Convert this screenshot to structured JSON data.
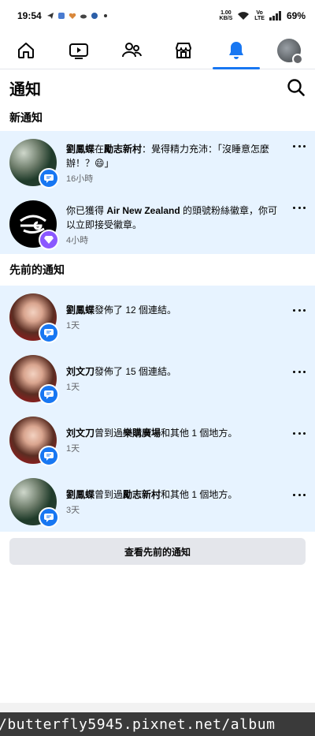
{
  "status": {
    "time": "19:54",
    "net_speed_top": "1.00",
    "net_speed_unit": "KB/S",
    "volte_top": "Vo",
    "volte_bottom": "LTE",
    "battery": "69%"
  },
  "nav": {
    "tabs": [
      "home-icon",
      "video-icon",
      "friends-icon",
      "marketplace-icon",
      "notifications-icon",
      "profile-menu"
    ],
    "active": "notifications-icon",
    "accent": "#1877f2"
  },
  "header": {
    "title": "通知"
  },
  "sections": {
    "new_title": "新通知",
    "earlier_title": "先前的通知"
  },
  "new_notifications": [
    {
      "name": "劉鳳蝶",
      "mid": "在",
      "place": "勵志新村",
      "rest": "：覺得精力充沛：「沒睡意怎麼辦！？😄」",
      "time": "16小時"
    },
    {
      "pre": "你已獲得 ",
      "name": "Air New Zealand",
      "rest": " 的頭號粉絲徽章，你可以立即接受徽章。",
      "time": "4小時"
    }
  ],
  "earlier_notifications": [
    {
      "name": "劉鳳蝶",
      "rest": "發佈了 12 個連結。",
      "time": "1天"
    },
    {
      "name": "刘文刀",
      "rest": "發佈了 15 個連結。",
      "time": "1天"
    },
    {
      "name": "刘文刀",
      "mid": "曾到過",
      "place": "樂購廣場",
      "rest": "和其他 1 個地方。",
      "time": "1天"
    },
    {
      "name": "劉鳳蝶",
      "mid": "曾到過",
      "place": "勵志新村",
      "rest": "和其他 1 個地方。",
      "time": "3天"
    }
  ],
  "see_more_label": "查看先前的通知",
  "url_overlay": "/butterfly5945.pixnet.net/album"
}
